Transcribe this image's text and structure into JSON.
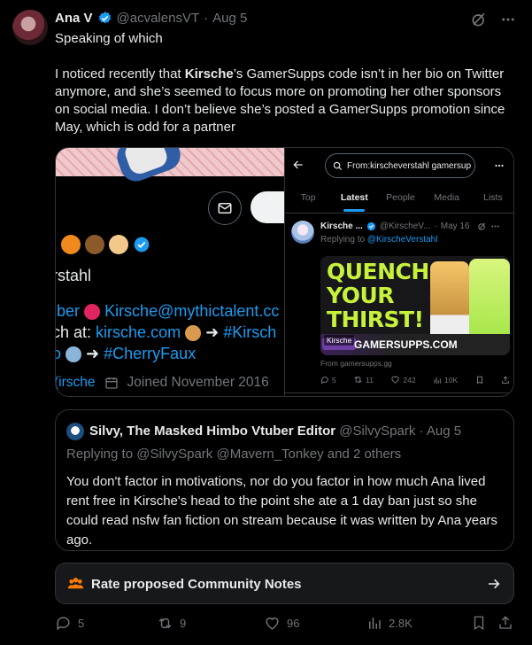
{
  "tweet": {
    "author_name": "Ana V",
    "handle": "@acvalensVT",
    "separator": "·",
    "date": "Aug 5",
    "line1": "Speaking of which",
    "body_prefix": "I noticed recently that ",
    "body_bold": "Kirsche",
    "body_rest": "’s GamerSupps code isn’t in her bio on Twitter anymore, and she’s seemed to focus more on promoting her other sponsors on social media. I don’t believe she’s posted a GamerSupps promotion since May, which is odd for a partner",
    "more_icon": "ellipsis-icon",
    "grok_icon": "slash-circle-icon"
  },
  "left_screenshot": {
    "name_fragment": "rstahl",
    "contact_prefix": "ıber",
    "contact_email": "Kirsche@mythictalent.cc",
    "watch_prefix": "ch at:",
    "watch_link": "kirsche.com",
    "watch_tag": "#Kirsch",
    "tag_prefix": "o",
    "tag_link": "#CherryFaux",
    "footer_link": "(irsche",
    "joined": "Joined November 2016"
  },
  "right_screenshot": {
    "search_value": "From:kirscheverstahl gamersup",
    "tabs": [
      "Top",
      "Latest",
      "People",
      "Media",
      "Lists"
    ],
    "active_tab": "Latest",
    "post_name": "Kirsche ...",
    "post_handle": "@KirscheV...",
    "post_date": "May 16",
    "replying_prefix": "Replying to",
    "replying_to": "@KirscheVerstahl",
    "ad_headline": [
      "QUENCH",
      "YOUR",
      "THIRST!"
    ],
    "ad_brand": "GAMERSUPPS.COM",
    "ad_tag": "Kirsche",
    "from_line": "From gamersupps.gg",
    "counts": {
      "replies": "5",
      "reposts": "11",
      "likes": "242",
      "views": "10K"
    }
  },
  "quote": {
    "author_name": "Silvy, The Masked Himbo Vtuber Editor",
    "handle": "@SilvySpark",
    "separator": "·",
    "date": "Aug 5",
    "replying_prefix": "Replying to",
    "replying_to": "@SilvySpark @Mavern_Tonkey",
    "replying_suffix": "and 2 others",
    "text": "You don't factor in motivations, nor do you factor in how much Ana lived rent free in Kirsche's head to the point she ate a 1 day ban just so she could read nsfw fan fiction on stream because it was written by Ana years ago."
  },
  "community_notes": {
    "label": "Rate proposed Community Notes"
  },
  "actions": {
    "replies": "5",
    "reposts": "9",
    "likes": "96",
    "views": "2.8K"
  },
  "colors": {
    "background": "#000000",
    "text": "#e7e9ea",
    "muted": "#71767b",
    "link": "#1d9bf0",
    "notes_icon": "#ff7a00"
  }
}
